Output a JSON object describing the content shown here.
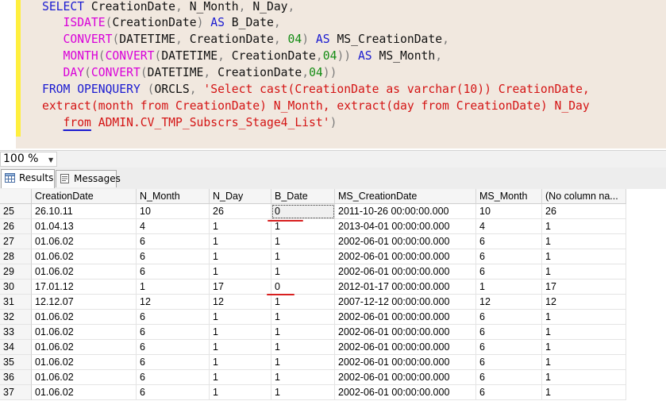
{
  "editor": {
    "lines": [
      [
        {
          "c": "kw",
          "t": "SELECT "
        },
        {
          "c": "tx",
          "t": "CreationDate"
        },
        {
          "c": "gr",
          "t": ", "
        },
        {
          "c": "tx",
          "t": "N_Month"
        },
        {
          "c": "gr",
          "t": ", "
        },
        {
          "c": "tx",
          "t": "N_Day"
        },
        {
          "c": "gr",
          "t": ","
        }
      ],
      [
        {
          "c": "tx",
          "t": "   "
        },
        {
          "c": "fn",
          "t": "ISDATE"
        },
        {
          "c": "gr",
          "t": "("
        },
        {
          "c": "tx",
          "t": "CreationDate"
        },
        {
          "c": "gr",
          "t": ")"
        },
        {
          "c": "kw",
          "t": " AS "
        },
        {
          "c": "tx",
          "t": "B_Date"
        },
        {
          "c": "gr",
          "t": ","
        }
      ],
      [
        {
          "c": "tx",
          "t": "   "
        },
        {
          "c": "fn",
          "t": "CONVERT"
        },
        {
          "c": "gr",
          "t": "("
        },
        {
          "c": "tx",
          "t": "DATETIME"
        },
        {
          "c": "gr",
          "t": ", "
        },
        {
          "c": "tx",
          "t": "CreationDate"
        },
        {
          "c": "gr",
          "t": ", "
        },
        {
          "c": "nm",
          "t": "04"
        },
        {
          "c": "gr",
          "t": ")"
        },
        {
          "c": "kw",
          "t": " AS "
        },
        {
          "c": "tx",
          "t": "MS_CreationDate"
        },
        {
          "c": "gr",
          "t": ","
        }
      ],
      [
        {
          "c": "tx",
          "t": "   "
        },
        {
          "c": "fn",
          "t": "MONTH"
        },
        {
          "c": "gr",
          "t": "("
        },
        {
          "c": "fn",
          "t": "CONVERT"
        },
        {
          "c": "gr",
          "t": "("
        },
        {
          "c": "tx",
          "t": "DATETIME"
        },
        {
          "c": "gr",
          "t": ", "
        },
        {
          "c": "tx",
          "t": "CreationDate"
        },
        {
          "c": "gr",
          "t": ","
        },
        {
          "c": "nm",
          "t": "04"
        },
        {
          "c": "gr",
          "t": "))"
        },
        {
          "c": "kw",
          "t": " AS "
        },
        {
          "c": "tx",
          "t": "MS_Month"
        },
        {
          "c": "gr",
          "t": ","
        }
      ],
      [
        {
          "c": "tx",
          "t": "   "
        },
        {
          "c": "fn",
          "t": "DAY"
        },
        {
          "c": "gr",
          "t": "("
        },
        {
          "c": "fn",
          "t": "CONVERT"
        },
        {
          "c": "gr",
          "t": "("
        },
        {
          "c": "tx",
          "t": "DATETIME"
        },
        {
          "c": "gr",
          "t": ", "
        },
        {
          "c": "tx",
          "t": "CreationDate"
        },
        {
          "c": "gr",
          "t": ","
        },
        {
          "c": "nm",
          "t": "04"
        },
        {
          "c": "gr",
          "t": "))"
        }
      ],
      [
        {
          "c": "kw",
          "t": "FROM "
        },
        {
          "c": "kw",
          "t": "OPENQUERY "
        },
        {
          "c": "gr",
          "t": "("
        },
        {
          "c": "tx",
          "t": "ORCLS"
        },
        {
          "c": "gr",
          "t": ", "
        },
        {
          "c": "st",
          "t": "'Select cast(CreationDate as varchar(10)) CreationDate,"
        }
      ],
      [
        {
          "c": "st",
          "t": "extract(month from CreationDate) N_Month, extract(day from CreationDate) N_Day"
        }
      ],
      [
        {
          "c": "tx",
          "t": "   "
        },
        {
          "c": "st sq",
          "t": "from"
        },
        {
          "c": "st",
          "t": " ADMIN.CV_TMP_Subscrs_Stage4_List'"
        },
        {
          "c": "gr",
          "t": ")"
        }
      ]
    ]
  },
  "zoom": {
    "value": "100 %"
  },
  "tabs": {
    "results": "Results",
    "messages": "Messages"
  },
  "grid": {
    "columns": [
      "",
      "CreationDate",
      "N_Month",
      "N_Day",
      "B_Date",
      "MS_CreationDate",
      "MS_Month",
      "(No column na..."
    ],
    "rows": [
      [
        "25",
        "26.10.11",
        "10",
        "26",
        "0",
        "2011-10-26 00:00:00.000",
        "10",
        "26"
      ],
      [
        "26",
        "01.04.13",
        "4",
        "1",
        "1",
        "2013-04-01 00:00:00.000",
        "4",
        "1"
      ],
      [
        "27",
        "01.06.02",
        "6",
        "1",
        "1",
        "2002-06-01 00:00:00.000",
        "6",
        "1"
      ],
      [
        "28",
        "01.06.02",
        "6",
        "1",
        "1",
        "2002-06-01 00:00:00.000",
        "6",
        "1"
      ],
      [
        "29",
        "01.06.02",
        "6",
        "1",
        "1",
        "2002-06-01 00:00:00.000",
        "6",
        "1"
      ],
      [
        "30",
        "17.01.12",
        "1",
        "17",
        "0",
        "2012-01-17 00:00:00.000",
        "1",
        "17"
      ],
      [
        "31",
        "12.12.07",
        "12",
        "12",
        "1",
        "2007-12-12 00:00:00.000",
        "12",
        "12"
      ],
      [
        "32",
        "01.06.02",
        "6",
        "1",
        "1",
        "2002-06-01 00:00:00.000",
        "6",
        "1"
      ],
      [
        "33",
        "01.06.02",
        "6",
        "1",
        "1",
        "2002-06-01 00:00:00.000",
        "6",
        "1"
      ],
      [
        "34",
        "01.06.02",
        "6",
        "1",
        "1",
        "2002-06-01 00:00:00.000",
        "6",
        "1"
      ],
      [
        "35",
        "01.06.02",
        "6",
        "1",
        "1",
        "2002-06-01 00:00:00.000",
        "6",
        "1"
      ],
      [
        "36",
        "01.06.02",
        "6",
        "1",
        "1",
        "2002-06-01 00:00:00.000",
        "6",
        "1"
      ],
      [
        "37",
        "01.06.02",
        "6",
        "1",
        "1",
        "2002-06-01 00:00:00.000",
        "6",
        "1"
      ]
    ]
  }
}
